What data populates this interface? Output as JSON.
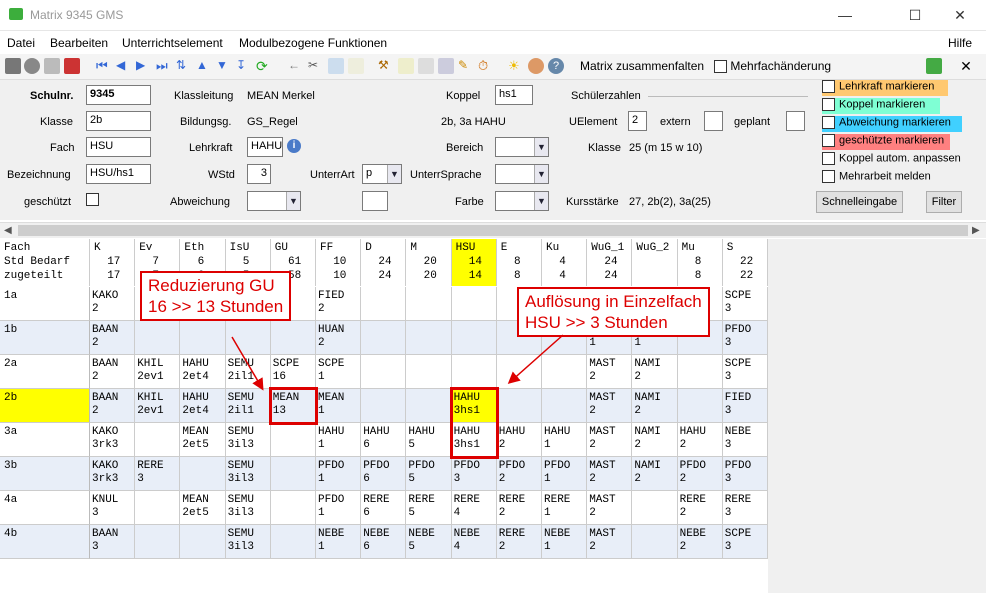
{
  "window": {
    "title": "Matrix 9345 GMS"
  },
  "menu": {
    "items": [
      "Datei",
      "Bearbeiten",
      "Unterrichtselement",
      "Modulbezogene Funktionen"
    ],
    "help": "Hilfe"
  },
  "toolbar": {
    "collapse_label": "Matrix zusammenfalten",
    "multi_label": "Mehrfachänderung"
  },
  "form": {
    "schulnr_label": "Schulnr.",
    "schulnr_value": "9345",
    "klasse_label": "Klasse",
    "klasse_value": "2b",
    "fach_label": "Fach",
    "fach_value": "HSU",
    "bezeichnung_label": "Bezeichnung",
    "bezeichnung_value": "HSU/hs1",
    "geschuetzt_label": "geschützt",
    "klassleitung_label": "Klassleitung",
    "klassleitung_value": "MEAN Merkel",
    "bildungsg_label": "Bildungsg.",
    "bildungsg_value": "GS_Regel",
    "lehrkraft_label": "Lehrkraft",
    "lehrkraft_value": "HAHU",
    "wstd_label": "WStd",
    "wstd_value": "3",
    "abweichung_label": "Abweichung",
    "unterrart_label": "UnterrArt",
    "unterrart_value": "p",
    "koppel_label": "Koppel",
    "koppel_value": "hs1",
    "koppel_info": "2b, 3a HAHU",
    "bereich_label": "Bereich",
    "untersprache_label": "UnterrSprache",
    "farbe_label": "Farbe",
    "schuelerzahlen_label": "Schülerzahlen",
    "uelement_label": "UElement",
    "uelement_value": "2",
    "extern_label": "extern",
    "geplant_label": "geplant",
    "klasse2_label": "Klasse",
    "klasse2_value": "25 (m 15 w 10)",
    "kursstaerke_label": "Kursstärke",
    "kursstaerke_value": "27, 2b(2), 3a(25)"
  },
  "options": {
    "lehrkraft_markieren": "Lehrkraft markieren",
    "koppel_markieren": "Koppel markieren",
    "abweichung_markieren": "Abweichung markieren",
    "geschuetzte_markieren": "geschützte markieren",
    "koppel_anpassen": "Koppel autom. anpassen",
    "mehrarbeit": "Mehrarbeit melden",
    "colors": {
      "lehrkraft": "#ffc870",
      "koppel": "#7fffd4",
      "abweichung": "#40d0ff",
      "geschuetzte": "#ff8080"
    }
  },
  "buttons": {
    "schnelleingabe": "Schnelleingabe",
    "filter": "Filter"
  },
  "grid": {
    "header_label": "Fach\nStd Bedarf\nzugeteilt",
    "subjects": [
      {
        "name": "K",
        "bedarf": "17",
        "zugeteilt": "17"
      },
      {
        "name": "Ev",
        "bedarf": "7",
        "zugeteilt": "7"
      },
      {
        "name": "Eth",
        "bedarf": "6",
        "zugeteilt": "6"
      },
      {
        "name": "IsU",
        "bedarf": "5",
        "zugeteilt": "5"
      },
      {
        "name": "GU",
        "bedarf": "61",
        "zugeteilt": "58"
      },
      {
        "name": "FF",
        "bedarf": "10",
        "zugeteilt": "10"
      },
      {
        "name": "D",
        "bedarf": "24",
        "zugeteilt": "24"
      },
      {
        "name": "M",
        "bedarf": "20",
        "zugeteilt": "20"
      },
      {
        "name": "HSU",
        "bedarf": "14",
        "zugeteilt": "14"
      },
      {
        "name": "E",
        "bedarf": "8",
        "zugeteilt": "8"
      },
      {
        "name": "Ku",
        "bedarf": "4",
        "zugeteilt": "4"
      },
      {
        "name": "WuG_1",
        "bedarf": "24",
        "zugeteilt": "24"
      },
      {
        "name": "WuG_2",
        "bedarf": "",
        "zugeteilt": ""
      },
      {
        "name": "Mu",
        "bedarf": "8",
        "zugeteilt": "8"
      },
      {
        "name": "S",
        "bedarf": "22",
        "zugeteilt": "22"
      }
    ],
    "rows": [
      {
        "class": "1a",
        "cells": [
          "KAKO\n2",
          "",
          "",
          "SEMU\n2il1",
          "",
          "FIED\n2",
          "",
          "",
          "",
          "",
          "",
          "",
          "",
          "",
          "SCPE\n3"
        ]
      },
      {
        "class": "1b",
        "cells": [
          "BAAN\n2",
          "",
          "",
          "",
          "",
          "HUAN\n2",
          "",
          "",
          "",
          "",
          "",
          "MAST\n1",
          "NAMI\n1",
          "",
          "PFDO\n3"
        ]
      },
      {
        "class": "2a",
        "cells": [
          "BAAN\n2",
          "KHIL\n2ev1",
          "HAHU\n2et4",
          "SEMU\n2il1",
          "SCPE\n16",
          "SCPE\n1",
          "",
          "",
          "",
          "",
          "",
          "MAST\n2",
          "NAMI\n2",
          "",
          "SCPE\n3"
        ]
      },
      {
        "class": "2b",
        "cells": [
          "BAAN\n2",
          "KHIL\n2ev1",
          "HAHU\n2et4",
          "SEMU\n2il1",
          "MEAN\n13",
          "MEAN\n1",
          "",
          "",
          "HAHU\n3hs1",
          "",
          "",
          "MAST\n2",
          "NAMI\n2",
          "",
          "FIED\n3"
        ]
      },
      {
        "class": "3a",
        "cells": [
          "KAKO\n3rk3",
          "",
          "MEAN\n2et5",
          "SEMU\n3il3",
          "",
          "HAHU\n1",
          "HAHU\n6",
          "HAHU\n5",
          "HAHU\n3hs1",
          "HAHU\n2",
          "HAHU\n1",
          "MAST\n2",
          "NAMI\n2",
          "HAHU\n2",
          "NEBE\n3"
        ]
      },
      {
        "class": "3b",
        "cells": [
          "KAKO\n3rk3",
          "RERE\n3",
          "",
          "SEMU\n3il3",
          "",
          "PFDO\n1",
          "PFDO\n6",
          "PFDO\n5",
          "PFDO\n3",
          "PFDO\n2",
          "PFDO\n1",
          "MAST\n2",
          "NAMI\n2",
          "PFDO\n2",
          "PFDO\n3"
        ]
      },
      {
        "class": "4a",
        "cells": [
          "KNUL\n3",
          "",
          "MEAN\n2et5",
          "SEMU\n3il3",
          "",
          "PFDO\n1",
          "RERE\n6",
          "RERE\n5",
          "RERE\n4",
          "RERE\n2",
          "RERE\n1",
          "MAST\n2",
          "",
          "RERE\n2",
          "RERE\n3"
        ]
      },
      {
        "class": "4b",
        "cells": [
          "BAAN\n3",
          "",
          "",
          "SEMU\n3il3",
          "",
          "NEBE\n1",
          "NEBE\n6",
          "NEBE\n5",
          "NEBE\n4",
          "RERE\n2",
          "NEBE\n1",
          "MAST\n2",
          "",
          "NEBE\n2",
          "SCPE\n3"
        ]
      }
    ]
  },
  "annotations": {
    "gu": "Reduzierung GU\n16 >> 13 Stunden",
    "hsu": "Auflösung in Einzelfach\nHSU >> 3 Stunden"
  }
}
